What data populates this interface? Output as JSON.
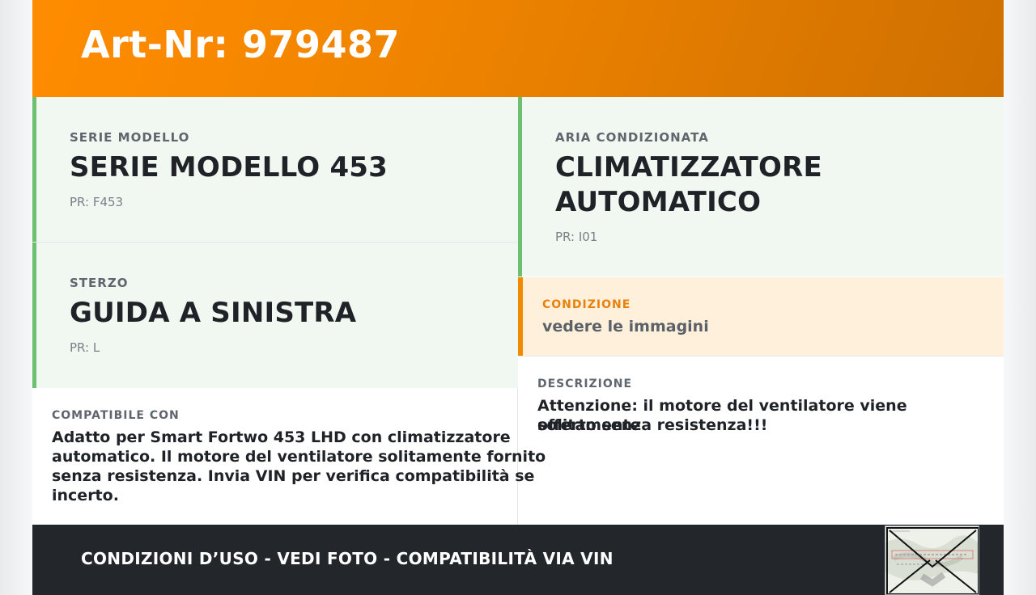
{
  "header": {
    "title": "Art-Nr: 979487"
  },
  "cards": {
    "serie": {
      "label": "SERIE MODELLO",
      "value": "SERIE MODELLO 453",
      "pr": "PR: F453"
    },
    "aria": {
      "label": "ARIA CONDIZIONATA",
      "value_line1": "CLIMATIZZATORE",
      "value_line2": "AUTOMATICO",
      "pr": "PR: I01"
    },
    "sterzo": {
      "label": "STERZO",
      "value": "GUIDA A SINISTRA",
      "pr": "PR: L"
    }
  },
  "condition": {
    "label": "CONDIZIONE",
    "text": "vedere le immagini"
  },
  "compatible": {
    "label": "COMPATIBILE CON",
    "lines": [
      "Adatto per Smart Fortwo 453 LHD con climatizzatore",
      "automatico. Il motore del ventilatore solitamente fornito",
      "senza resistenza. Invia VIN per verifica compatibilità se",
      "incerto."
    ]
  },
  "description": {
    "label": "DESCRIZIONE",
    "lines": [
      "Attenzione: il motore del ventilatore viene solitamente",
      "offerto senza resistenza!!!"
    ]
  },
  "footer": {
    "text": "CONDIZIONI D’USO - VEDI FOTO - COMPATIBILITÀ VIA VIN"
  },
  "thumbnail": {
    "icon": "part-label-photo-icon"
  },
  "colors": {
    "accent": "#f08a00",
    "green": "#6cc070",
    "footer_bg": "#23262b"
  }
}
